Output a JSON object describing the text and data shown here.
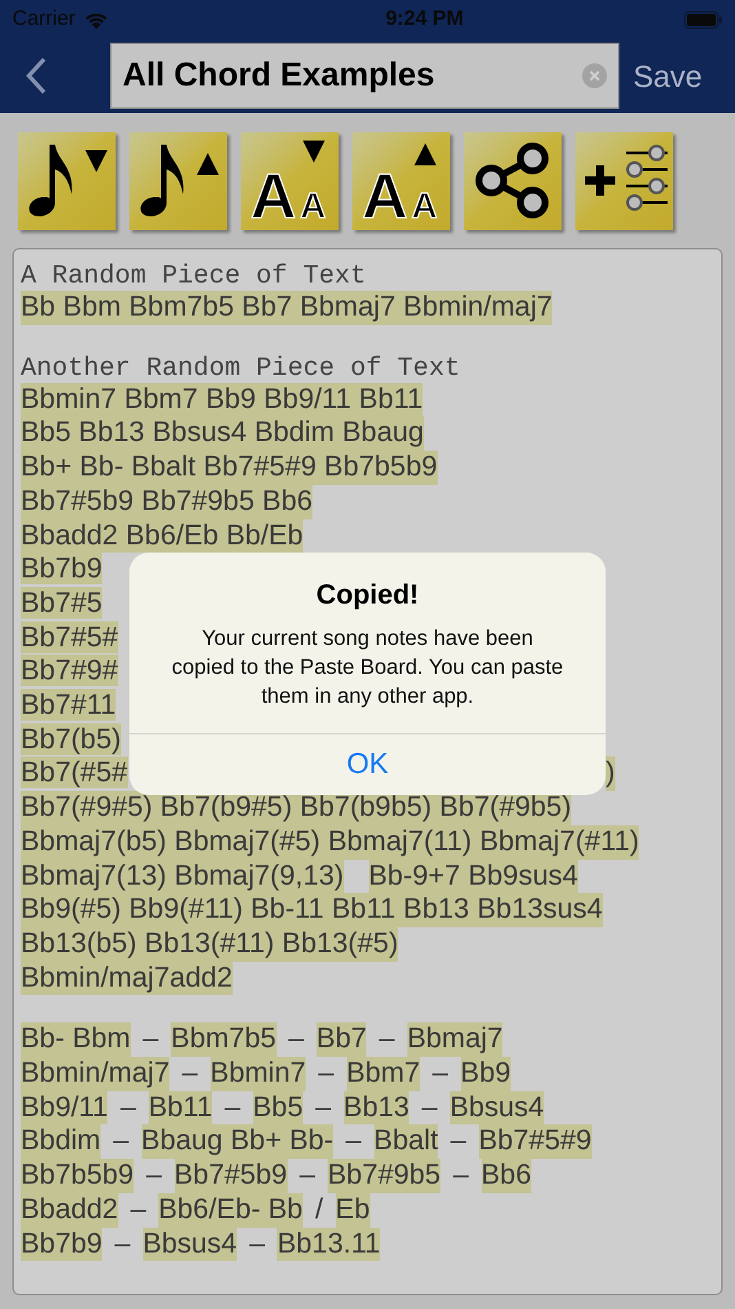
{
  "status_bar": {
    "carrier": "Carrier",
    "time": "9:24 PM"
  },
  "nav": {
    "title_field": {
      "value": "All Chord Examples"
    },
    "save": "Save"
  },
  "toolbar": [
    {
      "kind": "note-down"
    },
    {
      "kind": "note-up"
    },
    {
      "kind": "font-down",
      "glyph_large": "A",
      "glyph_small": "A"
    },
    {
      "kind": "font-up",
      "glyph_large": "A",
      "glyph_small": "A"
    },
    {
      "kind": "share"
    },
    {
      "kind": "add-settings"
    }
  ],
  "notes": [
    {
      "heading": "A Random Piece of Text",
      "lines": [
        {
          "tokens": [
            {
              "kind": "chord",
              "text": "Bb Bbm Bbm7b5 Bb7 Bbmaj7 Bbmin/maj7"
            }
          ]
        }
      ]
    },
    {
      "heading": "Another Random Piece of Text",
      "lines": [
        {
          "tokens": [
            {
              "kind": "chord",
              "text": "Bbmin7 Bbm7 Bb9 Bb9/11 Bb11"
            }
          ]
        },
        {
          "tokens": [
            {
              "kind": "chord",
              "text": "Bb5 Bb13 Bbsus4 Bbdim Bbaug"
            }
          ]
        },
        {
          "tokens": [
            {
              "kind": "chord",
              "text": "Bb+ Bb- Bbalt Bb7#5#9 Bb7b5b9"
            }
          ]
        },
        {
          "tokens": [
            {
              "kind": "chord",
              "text": "Bb7#5b9 Bb7#9b5 Bb6"
            }
          ]
        },
        {
          "tokens": [
            {
              "kind": "chord",
              "text": "Bbadd2 Bb6/Eb Bb/Eb"
            }
          ]
        },
        {
          "kind": "split",
          "left": "Bb7b9"
        },
        {
          "kind": "split",
          "left": "Bb7#5"
        },
        {
          "kind": "split",
          "left": "Bb7#5#"
        },
        {
          "kind": "split",
          "left": "Bb7#9#"
        },
        {
          "kind": "split",
          "left": "Bb7#11"
        },
        {
          "kind": "split",
          "left": "Bb7(b5)"
        },
        {
          "kind": "split",
          "left": "Bb7(#5#",
          "right": ")"
        },
        {
          "tokens": [
            {
              "kind": "chord",
              "text": "Bb7(#9#5) Bb7(b9#5) Bb7(b9b5) Bb7(#9b5)"
            }
          ]
        },
        {
          "tokens": [
            {
              "kind": "chord",
              "text": "Bbmaj7(b5) Bbmaj7(#5) Bbmaj7(11) Bbmaj7(#11)"
            }
          ]
        },
        {
          "tokens": [
            {
              "kind": "chord",
              "text": "Bbmaj7(13) Bbmaj7(9,13)"
            },
            {
              "kind": "gap"
            },
            {
              "kind": "chord",
              "text": "Bb-9+7 Bb9sus4"
            }
          ]
        },
        {
          "tokens": [
            {
              "kind": "chord",
              "text": "Bb9(#5) Bb9(#11) Bb-11 Bb11 Bb13 Bb13sus4"
            }
          ]
        },
        {
          "tokens": [
            {
              "kind": "chord",
              "text": "Bb13(b5) Bb13(#11) Bb13(#5)"
            }
          ]
        },
        {
          "tokens": [
            {
              "kind": "chord",
              "text": "Bbmin/maj7add2"
            }
          ]
        }
      ]
    },
    {
      "lines": [
        {
          "tokens": [
            {
              "kind": "chord",
              "text": "Bb- Bbm"
            },
            {
              "kind": "sep",
              "text": "–"
            },
            {
              "kind": "chord",
              "text": "Bbm7b5"
            },
            {
              "kind": "sep",
              "text": "–"
            },
            {
              "kind": "chord",
              "text": "Bb7"
            },
            {
              "kind": "sep",
              "text": "–"
            },
            {
              "kind": "chord",
              "text": "Bbmaj7"
            }
          ]
        },
        {
          "tokens": [
            {
              "kind": "chord",
              "text": "Bbmin/maj7"
            },
            {
              "kind": "sep",
              "text": "–"
            },
            {
              "kind": "chord",
              "text": "Bbmin7"
            },
            {
              "kind": "sep",
              "text": "–"
            },
            {
              "kind": "chord",
              "text": "Bbm7"
            },
            {
              "kind": "sep",
              "text": "–"
            },
            {
              "kind": "chord",
              "text": "Bb9"
            }
          ]
        },
        {
          "tokens": [
            {
              "kind": "chord",
              "text": "Bb9/11"
            },
            {
              "kind": "sep",
              "text": "–"
            },
            {
              "kind": "chord",
              "text": "Bb11"
            },
            {
              "kind": "sep",
              "text": "–"
            },
            {
              "kind": "chord",
              "text": "Bb5"
            },
            {
              "kind": "sep",
              "text": "–"
            },
            {
              "kind": "chord",
              "text": "Bb13"
            },
            {
              "kind": "sep",
              "text": "–"
            },
            {
              "kind": "chord",
              "text": "Bbsus4"
            }
          ]
        },
        {
          "tokens": [
            {
              "kind": "chord",
              "text": "Bbdim"
            },
            {
              "kind": "sep",
              "text": "–"
            },
            {
              "kind": "chord",
              "text": "Bbaug Bb+ Bb-"
            },
            {
              "kind": "sep",
              "text": "–"
            },
            {
              "kind": "chord",
              "text": "Bbalt"
            },
            {
              "kind": "sep",
              "text": "–"
            },
            {
              "kind": "chord",
              "text": "Bb7#5#9"
            }
          ]
        },
        {
          "tokens": [
            {
              "kind": "chord",
              "text": "Bb7b5b9"
            },
            {
              "kind": "sep",
              "text": "–"
            },
            {
              "kind": "chord",
              "text": "Bb7#5b9"
            },
            {
              "kind": "sep",
              "text": "–"
            },
            {
              "kind": "chord",
              "text": "Bb7#9b5"
            },
            {
              "kind": "sep",
              "text": "–"
            },
            {
              "kind": "chord",
              "text": "Bb6"
            }
          ]
        },
        {
          "tokens": [
            {
              "kind": "chord",
              "text": "Bbadd2"
            },
            {
              "kind": "sep",
              "text": "–"
            },
            {
              "kind": "chord",
              "text": "Bb6/Eb- Bb"
            },
            {
              "kind": "sep",
              "text": "/"
            },
            {
              "kind": "chord",
              "text": "Eb"
            }
          ]
        },
        {
          "tokens": [
            {
              "kind": "chord",
              "text": "Bb7b9"
            },
            {
              "kind": "sep",
              "text": "–"
            },
            {
              "kind": "chord",
              "text": "Bbsus4"
            },
            {
              "kind": "sep",
              "text": "–"
            },
            {
              "kind": "chord",
              "text": "Bb13.11"
            }
          ]
        }
      ]
    }
  ],
  "alert": {
    "title": "Copied!",
    "message": "Your current song notes have been copied to the Paste Board. You can paste them in any other app.",
    "button": "OK"
  }
}
